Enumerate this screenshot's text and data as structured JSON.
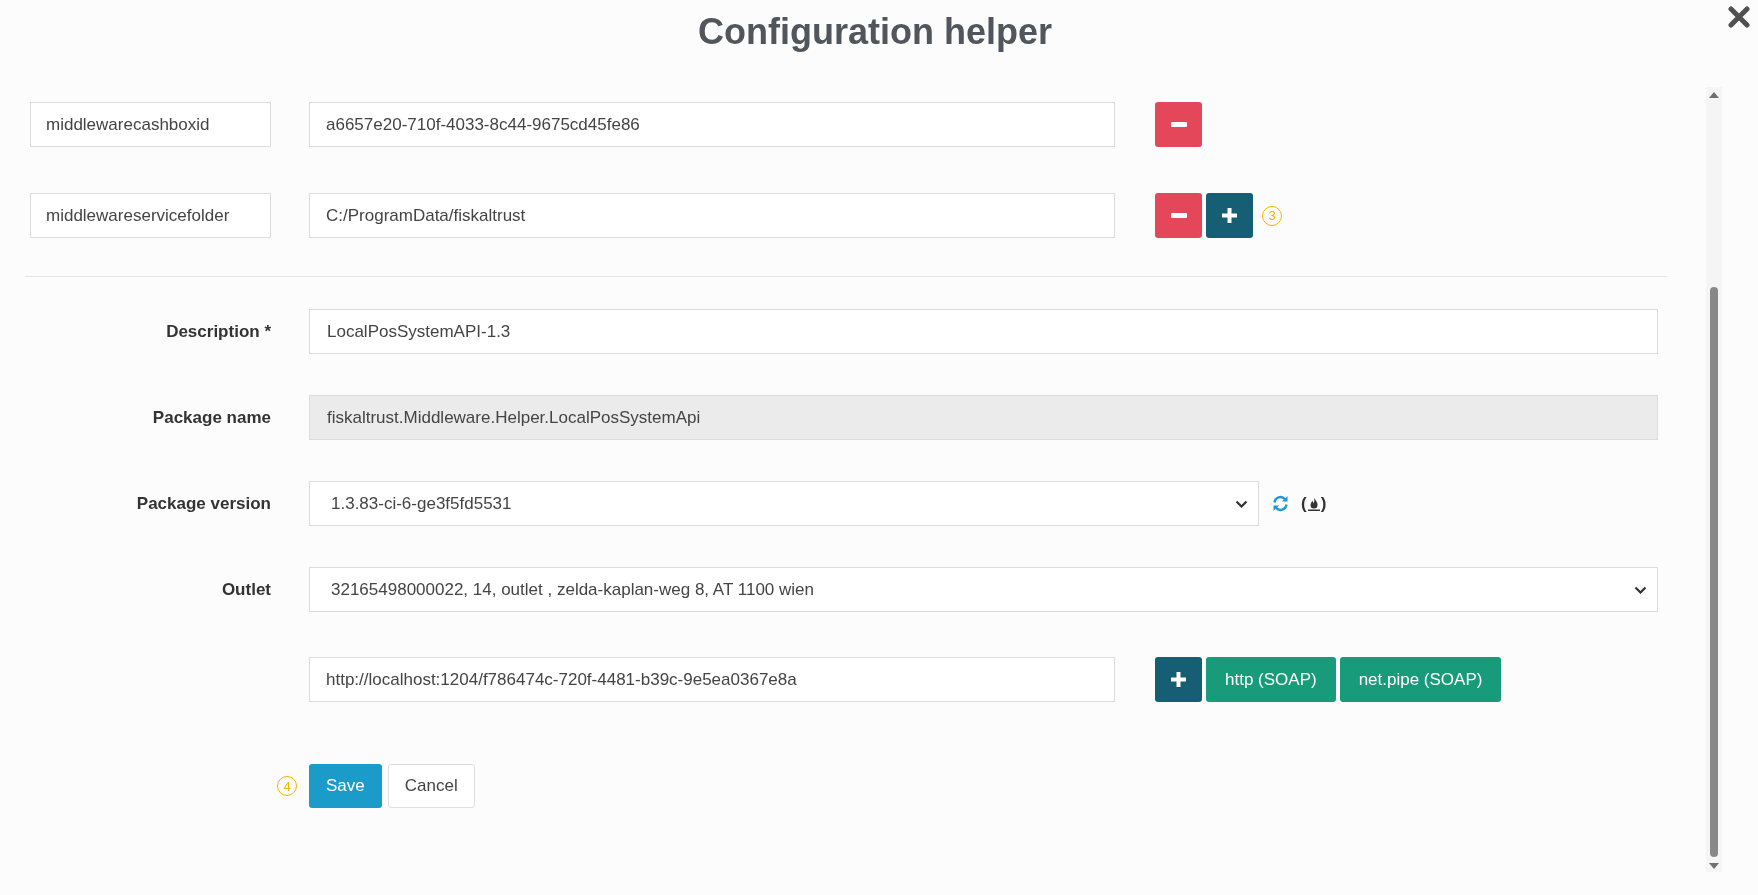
{
  "dialog": {
    "title": "Configuration helper"
  },
  "parameters": [
    {
      "key": "middlewarecashboxid",
      "value": "a6657e20-710f-4033-8c44-9675cd45fe86",
      "actions": [
        {
          "kind": "remove"
        }
      ]
    },
    {
      "key": "middlewareservicefolder",
      "value": "C:/ProgramData/fiskaltrust",
      "actions": [
        {
          "kind": "remove"
        },
        {
          "kind": "add"
        }
      ],
      "callout": "3"
    }
  ],
  "fields": [
    {
      "kind": "text",
      "label": "Description *",
      "value": "LocalPosSystemAPI-1.3",
      "disabled": false
    },
    {
      "kind": "text",
      "label": "Package name",
      "value": "fiskaltrust.Middleware.Helper.LocalPosSystemApi",
      "disabled": true
    },
    {
      "kind": "select",
      "label": "Package version",
      "value": "1.3.83-ci-6-ge3f5fd5531",
      "disabled": false,
      "refresh": true,
      "hint": {
        "open": "(",
        "close": ")"
      }
    },
    {
      "kind": "select",
      "label": "Outlet",
      "value": "32165498000022, 14, outlet , zelda-kaplan-weg 8, AT 1100 wien",
      "disabled": false
    }
  ],
  "endpoints": [
    {
      "value": "http://localhost:1204/f786474c-720f-4481-b39c-9e5ea0367e8a",
      "actions": [
        {
          "kind": "add"
        },
        {
          "kind": "protocol",
          "label": "http (SOAP)"
        },
        {
          "kind": "protocol",
          "label": "net.pipe (SOAP)"
        }
      ]
    }
  ],
  "form_actions": {
    "callout": "4",
    "buttons": [
      {
        "kind": "save",
        "label": "Save"
      },
      {
        "kind": "cancel",
        "label": "Cancel"
      }
    ]
  }
}
